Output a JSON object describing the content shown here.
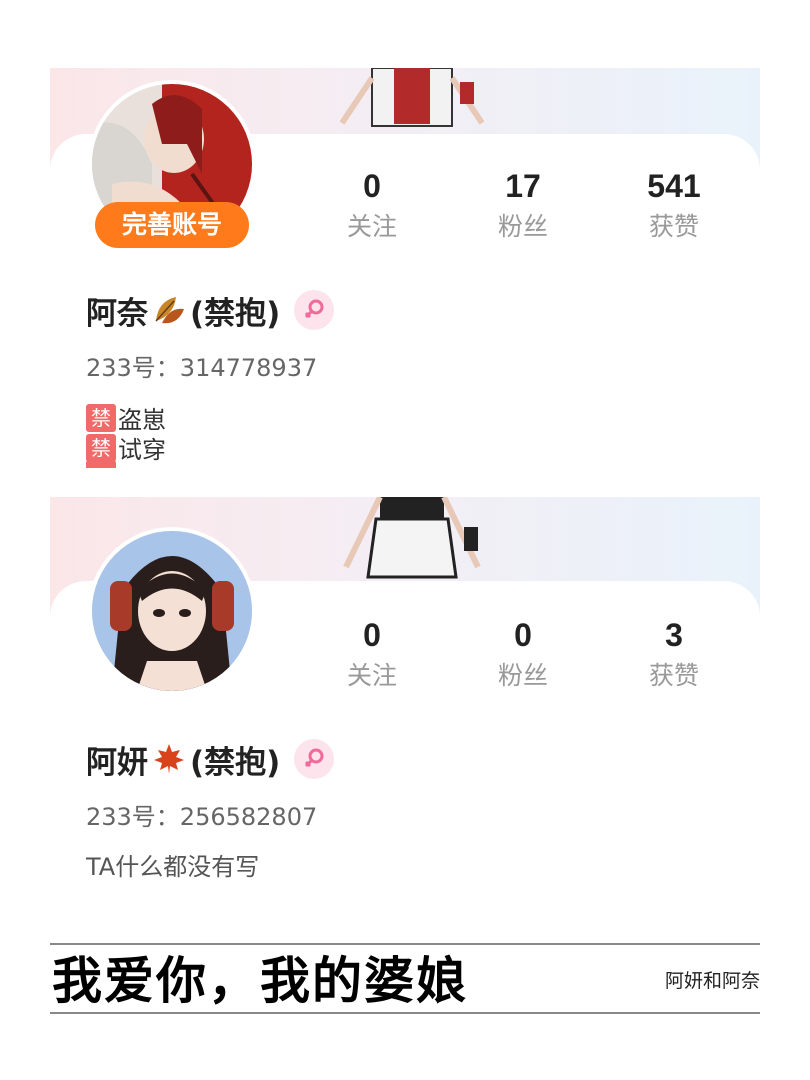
{
  "profiles": [
    {
      "badge": "完善账号",
      "stats": [
        {
          "value": "0",
          "label": "关注"
        },
        {
          "value": "17",
          "label": "粉丝"
        },
        {
          "value": "541",
          "label": "获赞"
        }
      ],
      "name_main": "阿奈",
      "name_suffix": "(禁抱)",
      "name_emoji": "fallen-leaf-icon",
      "uid": "233号：314778937",
      "bio_tags": [
        {
          "tag": "禁",
          "text": "盗崽"
        },
        {
          "tag": "禁",
          "text": "试穿"
        }
      ]
    },
    {
      "stats": [
        {
          "value": "0",
          "label": "关注"
        },
        {
          "value": "0",
          "label": "粉丝"
        },
        {
          "value": "3",
          "label": "获赞"
        }
      ],
      "name_main": "阿妍",
      "name_suffix": "(禁抱)",
      "name_emoji": "maple-leaf-icon",
      "uid": "233号：256582807",
      "bio": "TA什么都没有写"
    }
  ],
  "footer": {
    "headline": "我爱你，我的婆娘",
    "credit": "阿妍和阿奈"
  },
  "colors": {
    "badge": "#ff7a1a",
    "ban_tag": "#f06a6a",
    "gender_bg": "#fde3ec",
    "gender_symbol": "#f06a9a"
  }
}
